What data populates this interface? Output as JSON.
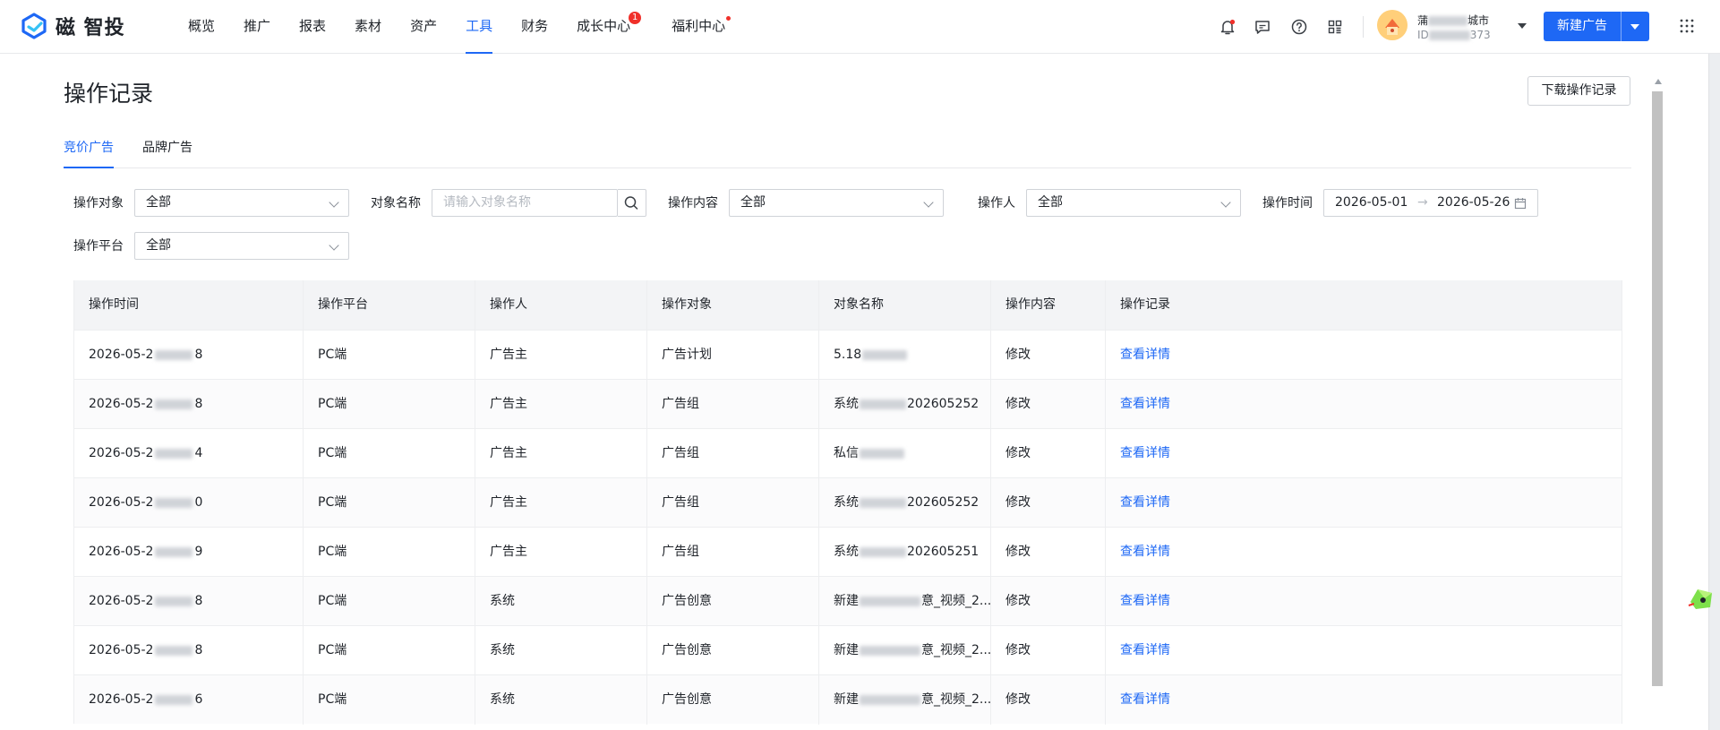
{
  "app": {
    "logo_text": "磁  智投"
  },
  "nav": {
    "items": [
      {
        "label": "概览"
      },
      {
        "label": "推广"
      },
      {
        "label": "报表"
      },
      {
        "label": "素材"
      },
      {
        "label": "资产"
      },
      {
        "label": "工具",
        "active": true
      },
      {
        "label": "财务"
      },
      {
        "label": "成长中心",
        "badge": "1"
      },
      {
        "label": "福利中心",
        "dot": true
      }
    ]
  },
  "header": {
    "user_name_prefix": "蒲",
    "user_name_suffix": "城市",
    "user_id_prefix": "ID",
    "user_id_suffix": "373",
    "new_ad_label": "新建广告",
    "icons": [
      "bell-icon",
      "message-icon",
      "help-icon",
      "app-grid-icon",
      "menu-grid-icon"
    ],
    "accent_color": "#1e68f5"
  },
  "page": {
    "title": "操作记录",
    "download_label": "下载操作记录",
    "tabs": [
      {
        "label": "竞价广告",
        "active": true
      },
      {
        "label": "品牌广告"
      }
    ]
  },
  "filters": {
    "object_label": "操作对象",
    "object_value": "全部",
    "name_label": "对象名称",
    "name_placeholder": "请输入对象名称",
    "content_label": "操作内容",
    "content_value": "全部",
    "operator_label": "操作人",
    "operator_value": "全部",
    "time_label": "操作时间",
    "time_start": "2026-05-01",
    "time_end": "2026-05-26",
    "platform_label": "操作平台",
    "platform_value": "全部"
  },
  "table": {
    "columns": [
      "操作时间",
      "操作平台",
      "操作人",
      "操作对象",
      "对象名称",
      "操作内容",
      "操作记录"
    ],
    "rows": [
      {
        "time_prefix": "2026-05-2",
        "time_suffix": "8",
        "platform": "PC端",
        "operator": "广告主",
        "object": "广告计划",
        "name_prefix": "5.18",
        "name_suffix": "",
        "content": "修改",
        "action": "查看详情"
      },
      {
        "time_prefix": "2026-05-2",
        "time_suffix": "8",
        "platform": "PC端",
        "operator": "广告主",
        "object": "广告组",
        "name_prefix": "系统",
        "name_suffix": "202605252",
        "content": "修改",
        "action": "查看详情"
      },
      {
        "time_prefix": "2026-05-2",
        "time_suffix": "4",
        "platform": "PC端",
        "operator": "广告主",
        "object": "广告组",
        "name_prefix": "私信",
        "name_suffix": "",
        "content": "修改",
        "action": "查看详情"
      },
      {
        "time_prefix": "2026-05-2",
        "time_suffix": "0",
        "platform": "PC端",
        "operator": "广告主",
        "object": "广告组",
        "name_prefix": "系统",
        "name_suffix": "202605252",
        "content": "修改",
        "action": "查看详情"
      },
      {
        "time_prefix": "2026-05-2",
        "time_suffix": "9",
        "platform": "PC端",
        "operator": "广告主",
        "object": "广告组",
        "name_prefix": "系统",
        "name_suffix": "202605251",
        "content": "修改",
        "action": "查看详情"
      },
      {
        "time_prefix": "2026-05-2",
        "time_suffix": "8",
        "platform": "PC端",
        "operator": "系统",
        "object": "广告创意",
        "name_prefix": "新建",
        "name_suffix": "意_视频_2...",
        "content": "修改",
        "action": "查看详情"
      },
      {
        "time_prefix": "2026-05-2",
        "time_suffix": "8",
        "platform": "PC端",
        "operator": "系统",
        "object": "广告创意",
        "name_prefix": "新建",
        "name_suffix": "意_视频_2...",
        "content": "修改",
        "action": "查看详情"
      },
      {
        "time_prefix": "2026-05-2",
        "time_suffix": "6",
        "platform": "PC端",
        "operator": "系统",
        "object": "广告创意",
        "name_prefix": "新建",
        "name_suffix": "意_视频_2...",
        "content": "修改",
        "action": "查看详情"
      }
    ]
  }
}
